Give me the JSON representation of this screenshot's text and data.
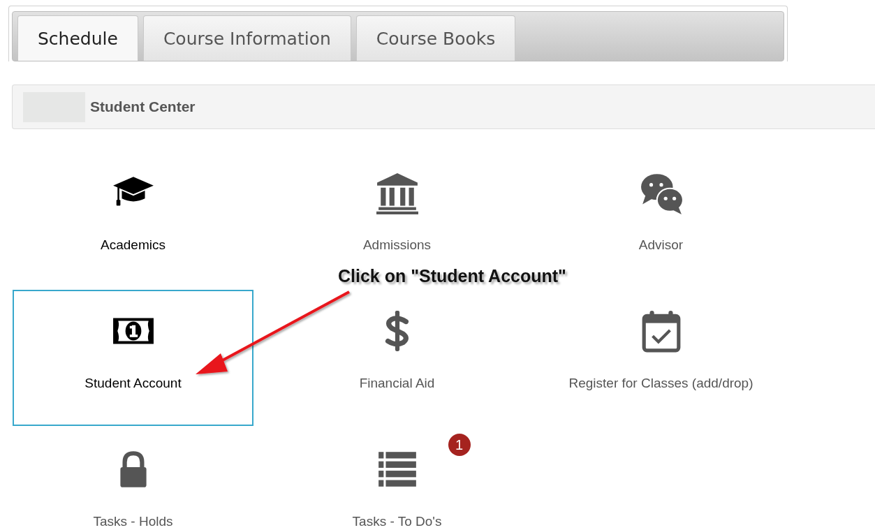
{
  "tabs": [
    {
      "label": "Schedule",
      "selected": true
    },
    {
      "label": "Course Information",
      "selected": false
    },
    {
      "label": "Course Books",
      "selected": false
    }
  ],
  "header": {
    "title": "Student Center"
  },
  "tiles": [
    {
      "label": "Academics",
      "selected": false,
      "highlighted": true
    },
    {
      "label": "Admissions",
      "selected": false,
      "highlighted": false
    },
    {
      "label": "Advisor",
      "selected": false,
      "highlighted": false
    },
    {
      "label": "Student Account",
      "selected": true,
      "highlighted": true
    },
    {
      "label": "Financial Aid",
      "selected": false,
      "highlighted": false
    },
    {
      "label": "Register for Classes (add/drop)",
      "selected": false,
      "highlighted": false
    },
    {
      "label": "Tasks - Holds",
      "selected": false,
      "highlighted": false
    },
    {
      "label": "Tasks - To Do's",
      "selected": false,
      "highlighted": false,
      "badge": "1"
    }
  ],
  "annotation": {
    "text": "Click on \"Student Account\""
  }
}
